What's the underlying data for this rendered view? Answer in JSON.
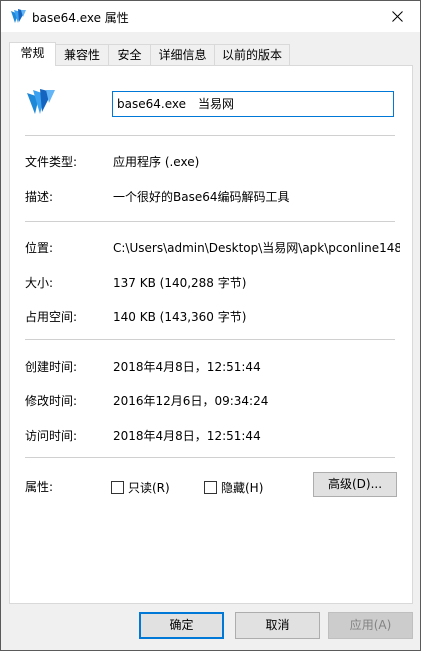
{
  "window": {
    "title": "base64.exe 属性",
    "icon": "app-feather-icon"
  },
  "tabs": [
    {
      "label": "常规",
      "active": true
    },
    {
      "label": "兼容性"
    },
    {
      "label": "安全"
    },
    {
      "label": "详细信息"
    },
    {
      "label": "以前的版本"
    }
  ],
  "general": {
    "file_name": "base64.exe　当易网",
    "fields": {
      "type_label": "文件类型:",
      "type_value": "应用程序 (.exe)",
      "desc_label": "描述:",
      "desc_value": "一个很好的Base64编码解码工具",
      "location_label": "位置:",
      "location_value": "C:\\Users\\admin\\Desktop\\当易网\\apk\\pconline148",
      "size_label": "大小:",
      "size_value": "137 KB (140,288 字节)",
      "disk_size_label": "占用空间:",
      "disk_size_value": "140 KB (143,360 字节)",
      "created_label": "创建时间:",
      "created_value": "2018年4月8日，12:51:44",
      "modified_label": "修改时间:",
      "modified_value": "2016年12月6日，09:34:24",
      "accessed_label": "访问时间:",
      "accessed_value": "2018年4月8日，12:51:44",
      "attributes_label": "属性:"
    },
    "attributes": {
      "readonly_label": "只读(R)",
      "readonly_checked": false,
      "hidden_label": "隐藏(H)",
      "hidden_checked": false,
      "advanced_label": "高级(D)..."
    }
  },
  "buttons": {
    "ok": "确定",
    "cancel": "取消",
    "apply": "应用(A)"
  },
  "colors": {
    "accent": "#0078d7",
    "icon_blue": "#1e88d8"
  }
}
